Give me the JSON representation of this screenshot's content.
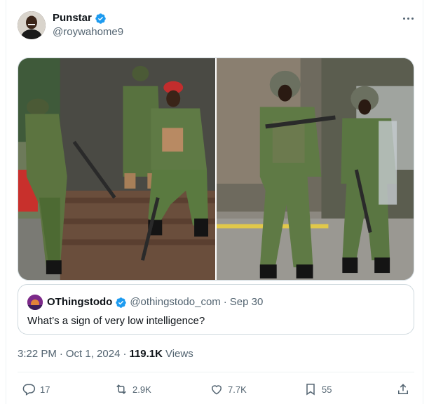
{
  "post": {
    "author": {
      "display_name": "Punstar",
      "handle": "@roywahome9",
      "verified_icon": "verified-badge-icon"
    },
    "more_icon": "more-dots-icon",
    "images": [
      {
        "description_icon": "photo-left"
      },
      {
        "description_icon": "photo-right"
      }
    ],
    "quoted": {
      "display_name": "OThingstodo",
      "handle": "@othingstodo_com",
      "separator": "·",
      "date": "Sep 30",
      "text": "What’s a sign of very low intelligence?"
    },
    "meta": {
      "time": "3:22 PM",
      "separator1": "·",
      "date": "Oct 1, 2024",
      "separator2": "·",
      "views_count": "119.1K",
      "views_label": "Views"
    },
    "actions": {
      "replies": "17",
      "reposts": "2.9K",
      "likes": "7.7K",
      "bookmarks": "55"
    }
  },
  "colors": {
    "accent": "#1d9bf0",
    "text_primary": "#0f1419",
    "text_secondary": "#536471",
    "border": "#cfd9de"
  }
}
